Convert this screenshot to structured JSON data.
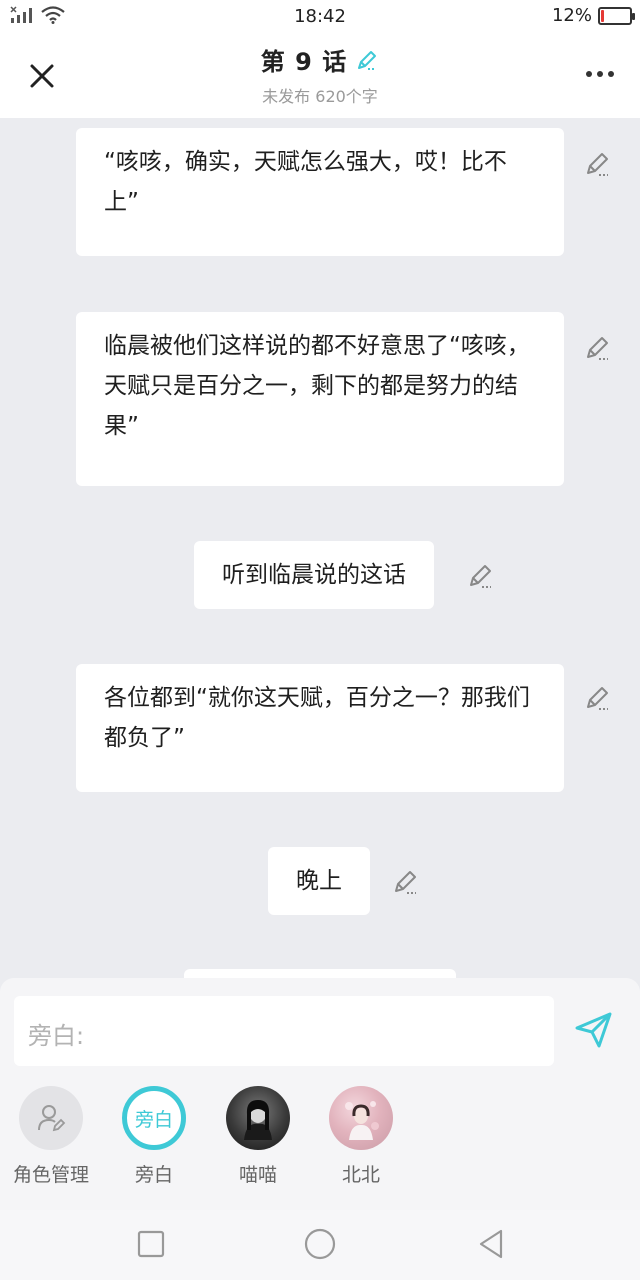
{
  "status_bar": {
    "time": "18:42",
    "battery": "12%",
    "battery_level": 0.12
  },
  "header": {
    "title": "第 9 话",
    "subtitle": "未发布 620个字"
  },
  "messages": [
    {
      "text": "“咳咳，确实，天赋怎么强大，哎！比不上”"
    },
    {
      "text": "临晨被他们这样说的都不好意思了“咳咳，天赋只是百分之一，剩下的都是努力的结果”"
    },
    {
      "text": "听到临晨说的这话"
    },
    {
      "text": "各位都到“就你这天赋，百分之一？那我们都负了”"
    },
    {
      "text": "晚上"
    }
  ],
  "composer": {
    "placeholder": "旁白:"
  },
  "roles": [
    {
      "label": "角色管理",
      "badge": ""
    },
    {
      "label": "旁白",
      "badge": "旁白"
    },
    {
      "label": "喵喵",
      "badge": ""
    },
    {
      "label": "北北",
      "badge": ""
    }
  ],
  "colors": {
    "accent": "#3ec9d6",
    "background": "#ebecf0"
  }
}
